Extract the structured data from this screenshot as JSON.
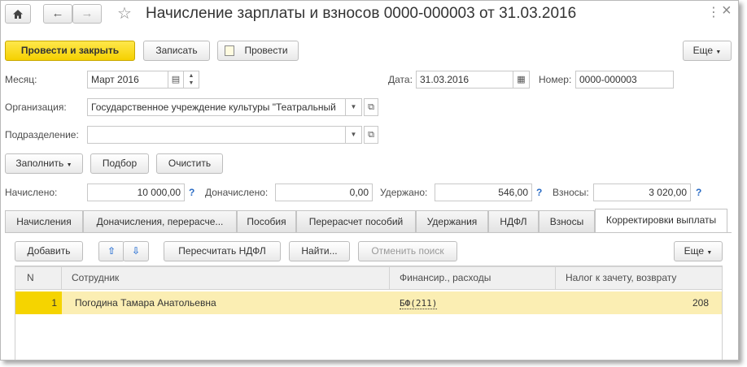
{
  "window": {
    "title": "Начисление зарплаты и взносов 0000-000003 от 31.03.2016",
    "more_menu": "⋮",
    "close": "×"
  },
  "toolbar": {
    "post_close": "Провести и закрыть",
    "save": "Записать",
    "post": "Провести",
    "more": "Еще"
  },
  "header": {
    "month_label": "Месяц:",
    "month_value": "Март 2016",
    "date_label": "Дата:",
    "date_value": "31.03.2016",
    "number_label": "Номер:",
    "number_value": "0000-000003",
    "org_label": "Организация:",
    "org_value": "Государственное учреждение культуры \"Театральный",
    "dept_label": "Подразделение:",
    "dept_value": ""
  },
  "actions": {
    "fill": "Заполнить",
    "select": "Подбор",
    "clear": "Очистить"
  },
  "totals": {
    "accrued_label": "Начислено:",
    "accrued_value": "10 000,00",
    "extra_label": "Доначислено:",
    "extra_value": "0,00",
    "withheld_label": "Удержано:",
    "withheld_value": "546,00",
    "contrib_label": "Взносы:",
    "contrib_value": "3 020,00",
    "help": "?"
  },
  "tabs": [
    {
      "label": "Начисления"
    },
    {
      "label": "Доначисления, перерасче..."
    },
    {
      "label": "Пособия"
    },
    {
      "label": "Перерасчет пособий"
    },
    {
      "label": "Удержания"
    },
    {
      "label": "НДФЛ"
    },
    {
      "label": "Взносы"
    },
    {
      "label": "Корректировки выплаты"
    }
  ],
  "tab_toolbar": {
    "add": "Добавить",
    "recalc": "Пересчитать НДФЛ",
    "find": "Найти...",
    "cancel_search": "Отменить поиск",
    "more": "Еще"
  },
  "table": {
    "columns": [
      "N",
      "Сотрудник",
      "Финансир., расходы",
      "Налог к зачету, возврату"
    ],
    "rows": [
      {
        "n": "1",
        "employee": "Погодина Тамара Анатольевна",
        "finance": "БФ(211)",
        "tax": "208"
      }
    ]
  }
}
